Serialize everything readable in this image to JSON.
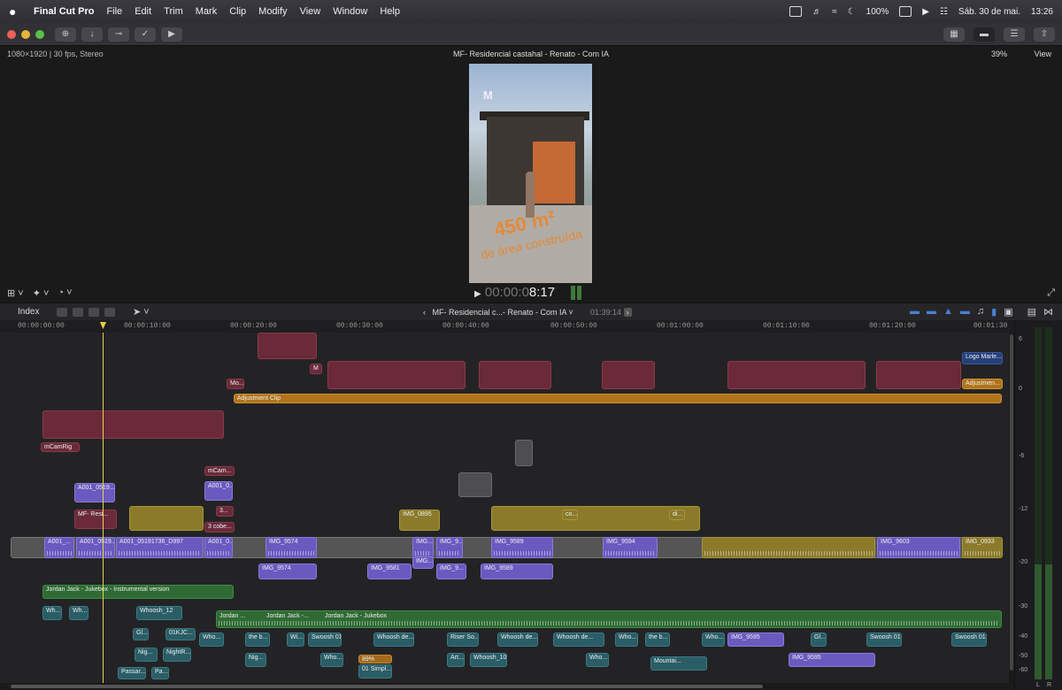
{
  "menubar": {
    "app_name": "Final Cut Pro",
    "menus": [
      "File",
      "Edit",
      "Trim",
      "Mark",
      "Clip",
      "Modify",
      "View",
      "Window",
      "Help"
    ],
    "battery": "100%",
    "date": "Sáb. 30 de mai.",
    "time": "13:26"
  },
  "viewer": {
    "format_info": "1080×1920 | 30 fps, Stereo",
    "project_title": "MF- Residencial castahal - Renato - Com IA",
    "zoom": "39%",
    "view_menu": "View",
    "timecode_dim": "00:00:0",
    "timecode_bright": "8:17",
    "overlay_big": "450 m²",
    "overlay_sub": "de área construída"
  },
  "timeline_header": {
    "index_label": "Index",
    "project_title": "MF- Residencial c...- Renato - Com IA",
    "duration": "01:39:14"
  },
  "ruler": [
    "00:00:00:00",
    "00:00:10:00",
    "00:00:20:00",
    "00:00:30:00",
    "00:00:40:00",
    "00:00:50:00",
    "00:01:00:00",
    "00:01:10:00",
    "00:01:20:00",
    "00:01:30"
  ],
  "clips": {
    "adjustment": "Adjustment Clip",
    "adjustment2": "Adjustmen...",
    "logo": "Logo Marle...",
    "mo": "Mo...",
    "mcamrig": "mCamRig",
    "mcam": "mCam...",
    "a001_1": "A001_0519...",
    "a001_2": "A001_0...",
    "a001_3": "A001_0519...",
    "a001_4": "A001_05191736_D997",
    "a001_5": "A001_0...",
    "a001_6": "A001_...",
    "mf_resi": "MF- Resi...",
    "cobe": "3 cobe...",
    "three": "3...",
    "img0895": "IMG_0895",
    "img9574": "IMG_9574",
    "img9574b": "IMG_9574",
    "img9581": "IMG_9581",
    "img9589": "IMG_9589",
    "img9589b": "IMG_9589",
    "img9594": "IMG_9594",
    "img9603": "IMG_9603",
    "img0933": "IMG_0933",
    "img9595": "IMG_9595",
    "img9595b": "IMG_9595",
    "img9": "IMG_9...",
    "img9b": "IMG_9...",
    "img": "IMG...",
    "jordan1": "Jordan Jack - Jukebox - Instrumental version",
    "jordan2": "Jordan Jack - Jukebox",
    "jordan3": "Jordan Jack -...",
    "jordan4": "Jordan ...",
    "whoosh12": "Whoosh_12",
    "whoosh10": "Whoosh_10",
    "swoosh1": "Swoosh 01",
    "swoosh2": "Swoosh 01",
    "swoosh3": "Swoosh 01",
    "whooshde1": "Whoosh de...",
    "whooshde2": "Whoosh de...",
    "whooshde3": "Whoosh de...",
    "riser": "Riser So...",
    "mountain": "Mountai...",
    "night1": "Nig...",
    "night2": "NightR...",
    "night3": "Nig...",
    "gl1": "Gl...",
    "gl2": "Gl...",
    "k01": "01KJC...",
    "simpl": "01 Simpl...",
    "speed": "89%",
    "passar": "Passar...",
    "pa": "Pa...",
    "art": "Art...",
    "theb1": "the b...",
    "theb2": "the b...",
    "who": "Who...",
    "wh": "Wh...",
    "wi": "Wi...",
    "co": "co...",
    "di": "di...",
    "m": "M"
  },
  "meter_labels": [
    "6",
    "0",
    "-6",
    "-12",
    "-20",
    "-30",
    "-40",
    "-50",
    "-60"
  ],
  "meter_lr": [
    "L",
    "R"
  ]
}
